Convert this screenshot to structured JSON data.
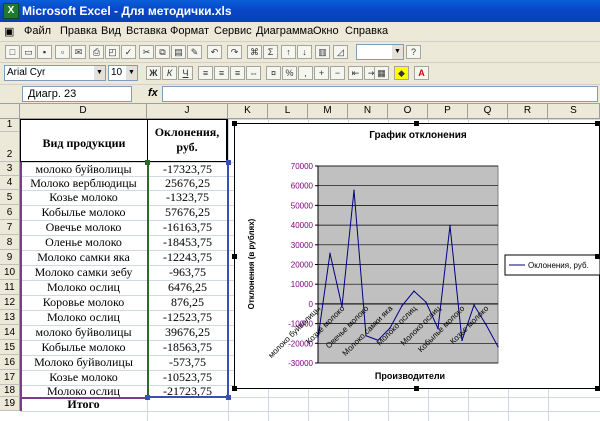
{
  "window": {
    "title": "Microsoft Excel - Для методички.xls"
  },
  "menu": [
    "Файл",
    "Правка",
    "Вид",
    "Вставка",
    "Формат",
    "Сервис",
    "Диаграмма",
    "Окно",
    "Справка"
  ],
  "toolbar": {
    "font": "Arial Cyr",
    "size": "10"
  },
  "formula_bar": {
    "name_box": "Диагр. 23",
    "fx": "fx"
  },
  "columns": [
    "D",
    "J",
    "K",
    "L",
    "M",
    "N",
    "O",
    "P",
    "Q",
    "R",
    "S"
  ],
  "rows": [
    "1",
    "2",
    "3",
    "4",
    "5",
    "6",
    "7",
    "8",
    "9",
    "10",
    "11",
    "12",
    "13",
    "14",
    "15",
    "16",
    "17",
    "18",
    "19"
  ],
  "sheet": {
    "header_product": "Вид продукции",
    "header_dev": "Оклонения, руб.",
    "total": "Итого",
    "rows": [
      {
        "product": "молоко буйволицы",
        "dev": "-17323,75"
      },
      {
        "product": "Молоко верблюдицы",
        "dev": "25676,25"
      },
      {
        "product": "Козье молоко",
        "dev": "-1323,75"
      },
      {
        "product": "Кобылье молоко",
        "dev": "57676,25"
      },
      {
        "product": "Овечье молоко",
        "dev": "-16163,75"
      },
      {
        "product": "Оленье молоко",
        "dev": "-18453,75"
      },
      {
        "product": "Молоко самки яка",
        "dev": "-12243,75"
      },
      {
        "product": "Молоко самки зебу",
        "dev": "-963,75"
      },
      {
        "product": "Молоко ослиц",
        "dev": "6476,25"
      },
      {
        "product": "Коровье молоко",
        "dev": "876,25"
      },
      {
        "product": "Молоко ослиц",
        "dev": "-12523,75"
      },
      {
        "product": "молоко буйволицы",
        "dev": "39676,25"
      },
      {
        "product": "Кобылье молоко",
        "dev": "-18563,75"
      },
      {
        "product": "Молоко буйволицы",
        "dev": "-573,75"
      },
      {
        "product": "Козье молоко",
        "dev": "-10523,75"
      },
      {
        "product": "Молоко ослиц",
        "dev": "-21723,75"
      }
    ]
  },
  "chart_data": {
    "type": "line",
    "title": "График отклонения",
    "xlabel": "Производители",
    "ylabel": "Отклонения (в рублях)",
    "categories": [
      "молоко буйволицы",
      "Молоко верблюдицы",
      "Козье молоко",
      "Кобылье молоко",
      "Овечье молоко",
      "Оленье молоко",
      "Молоко самки яка",
      "Молоко самки зебу",
      "Молоко ослиц",
      "Коровье молоко",
      "Молоко ослиц",
      "молоко буйволицы",
      "Кобылье молоко",
      "Молоко буйволицы",
      "Козье молоко",
      "Молоко ослиц"
    ],
    "x_tick_labels": [
      "молоко буйволицы",
      "Козье молоко",
      "Овечье молоко",
      "Молоко самки яка",
      "Молоко ослиц",
      "Молоко ослиц",
      "Кобылье молоко",
      "Козье молоко"
    ],
    "series": [
      {
        "name": "Оклонения, руб.",
        "values": [
          -17323.75,
          25676.25,
          -1323.75,
          57676.25,
          -16163.75,
          -18453.75,
          -12243.75,
          -963.75,
          6476.25,
          876.25,
          -12523.75,
          39676.25,
          -18563.75,
          -573.75,
          -10523.75,
          -21723.75
        ]
      }
    ],
    "y_ticks": [
      "70000",
      "60000",
      "50000",
      "40000",
      "30000",
      "20000",
      "10000",
      "0",
      "-10000",
      "-20000",
      "-30000"
    ],
    "ylim": [
      -30000,
      70000
    ],
    "legend": "right",
    "grid": true,
    "colors": {
      "plot_bg": "#c0c0c0",
      "line": "#000080",
      "tick_text": "#800080"
    }
  }
}
